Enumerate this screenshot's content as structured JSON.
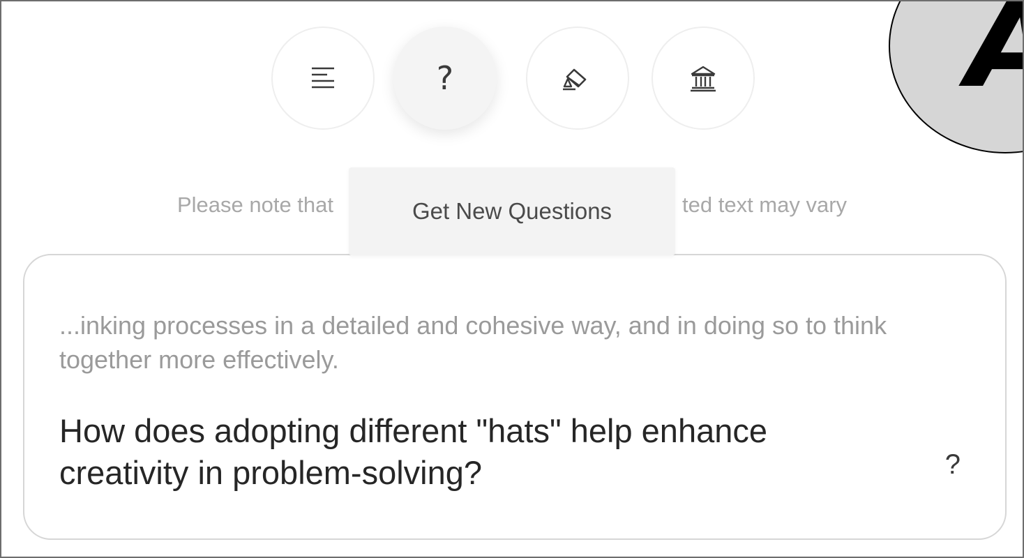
{
  "toolbar": {
    "buttons": [
      {
        "name": "summary",
        "icon": "align-left-lines-icon"
      },
      {
        "name": "questions",
        "icon": "question-mark-icon",
        "glyph": "?",
        "active": true
      },
      {
        "name": "highlight",
        "icon": "highlighter-icon"
      },
      {
        "name": "library",
        "icon": "bank-building-icon"
      }
    ]
  },
  "tooltip": {
    "text": "Get New Questions"
  },
  "notice": {
    "text_visible_left": "Please note that",
    "text_visible_right": "ted text may vary"
  },
  "card": {
    "context": "...inking processes in a detailed and cohesive way, and in doing so to think together more effectively.",
    "question": "How does adopting different \"hats\" help enhance creativity in problem-solving?",
    "action_glyph": "?"
  },
  "corner_badge": {
    "letter": "A"
  },
  "colors": {
    "border": "#6e6e6e",
    "muted_text": "#a8a8a8",
    "question_text": "#262626",
    "tooltip_bg": "#f3f3f3"
  }
}
